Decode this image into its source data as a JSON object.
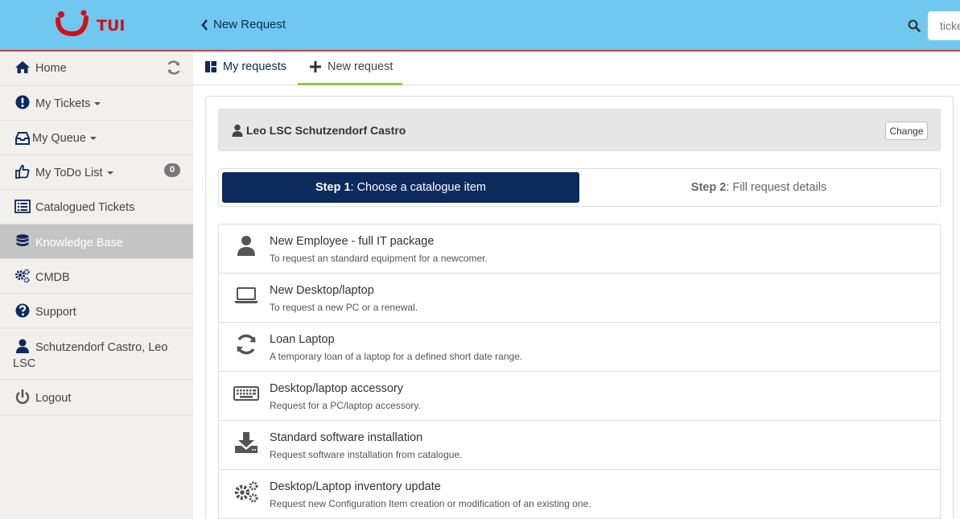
{
  "header": {
    "logo_text": "TUI",
    "back_label": "New Request",
    "search_placeholder": "ticket",
    "colors": {
      "bar": "#70c8f0",
      "logo": "#d40e14"
    }
  },
  "sidebar": {
    "items": [
      {
        "label": "Home",
        "icon": "home-icon"
      },
      {
        "label": "My Tickets",
        "icon": "exclamation-icon"
      },
      {
        "label": "My Queue",
        "icon": "inbox-icon"
      },
      {
        "label": "My ToDo List",
        "icon": "thumbs-up-icon",
        "badge": "0"
      },
      {
        "label": "Catalogued Tickets",
        "icon": "list-icon"
      },
      {
        "label": "Knowledge Base",
        "icon": "database-icon"
      },
      {
        "label": "CMDB",
        "icon": "gears-icon"
      },
      {
        "label": "Support",
        "icon": "question-icon"
      },
      {
        "label": "Schutzendorf Castro, Leo LSC",
        "icon": "user-icon"
      },
      {
        "label": "Logout",
        "icon": "power-icon"
      }
    ]
  },
  "tabs": [
    {
      "label": "My requests",
      "icon": "dashboard-icon"
    },
    {
      "label": "New request",
      "icon": "plus-icon",
      "active": true
    }
  ],
  "user_bar": {
    "name": "Leo LSC Schutzendorf Castro",
    "change_label": "Change"
  },
  "steps": [
    {
      "num": "Step 1",
      "text": ": Choose a catalogue item",
      "active": true
    },
    {
      "num": "Step 2",
      "text": ": Fill request details",
      "active": false
    }
  ],
  "catalogue": [
    {
      "title": "New Employee - full IT package",
      "desc": "To request an standard equipment for a newcomer.",
      "icon": "user-icon"
    },
    {
      "title": "New Desktop/laptop",
      "desc": "To request a new PC or a renewal.",
      "icon": "laptop-icon"
    },
    {
      "title": "Loan Laptop",
      "desc": "A temporary loan of a laptop for a defined short date range.",
      "icon": "refresh-icon"
    },
    {
      "title": "Desktop/laptop accessory",
      "desc": "Request for a PC/laptop accessory.",
      "icon": "keyboard-icon"
    },
    {
      "title": "Standard software installation",
      "desc": "Request software installation from catalogue.",
      "icon": "download-icon"
    },
    {
      "title": "Desktop/Laptop inventory update",
      "desc": "Request new Configuration Item creation or modification of an existing one.",
      "icon": "gears-icon"
    }
  ]
}
